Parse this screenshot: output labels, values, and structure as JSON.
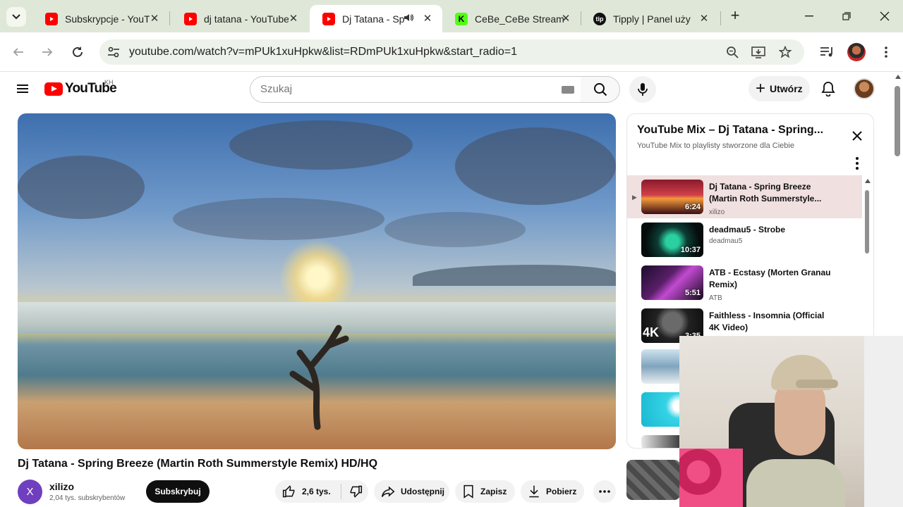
{
  "browser": {
    "tabs": [
      {
        "title": "Subskrypcje - YouTube",
        "favicon": "youtube-icon",
        "active": false,
        "audio": false
      },
      {
        "title": "dj tatana - YouTube",
        "favicon": "youtube-icon",
        "active": false,
        "audio": false
      },
      {
        "title": "Dj Tatana - Spring Breeze",
        "favicon": "youtube-icon",
        "active": true,
        "audio": true
      },
      {
        "title": "CeBe_CeBe Stream",
        "favicon": "kick-icon",
        "active": false,
        "audio": false
      },
      {
        "title": "Tipply | Panel użytkownika",
        "favicon": "tipply-icon",
        "active": false,
        "audio": false
      }
    ],
    "url": "youtube.com/watch?v=mPUk1xuHpkw&list=RDmPUk1xuHpkw&start_radio=1"
  },
  "yt": {
    "logo_text": "YouTube",
    "country_code": "KH",
    "search_placeholder": "Szukaj",
    "create_label": "Utwórz"
  },
  "video": {
    "title": "Dj Tatana - Spring Breeze (Martin Roth Summerstyle Remix) HD/HQ",
    "channel": {
      "initial": "X",
      "name": "xilizo",
      "subscribers": "2,04 tys. subskrybentów"
    },
    "subscribe_label": "Subskrybuj",
    "likes": "2,6 tys.",
    "share_label": "Udostępnij",
    "save_label": "Zapisz",
    "download_label": "Pobierz"
  },
  "playlist": {
    "title": "YouTube Mix – Dj Tatana - Spring...",
    "subtitle": "YouTube Mix to playlisty stworzone dla Ciebie",
    "items": [
      {
        "title": "Dj Tatana - Spring Breeze (Martin Roth Summerstyle...",
        "channel": "xilizo",
        "duration": "6:24",
        "current": true
      },
      {
        "title": "deadmau5 - Strobe",
        "channel": "deadmau5",
        "duration": "10:37",
        "current": false
      },
      {
        "title": "ATB - Ecstasy (Morten Granau Remix)",
        "channel": "ATB",
        "duration": "5:51",
        "current": false
      },
      {
        "title": "Faithless - Insomnia (Official 4K Video)",
        "channel": "",
        "duration": "3:35",
        "current": false
      }
    ]
  },
  "colors": {
    "brand_red": "#ff0000",
    "active_row": "#f0e0df"
  }
}
